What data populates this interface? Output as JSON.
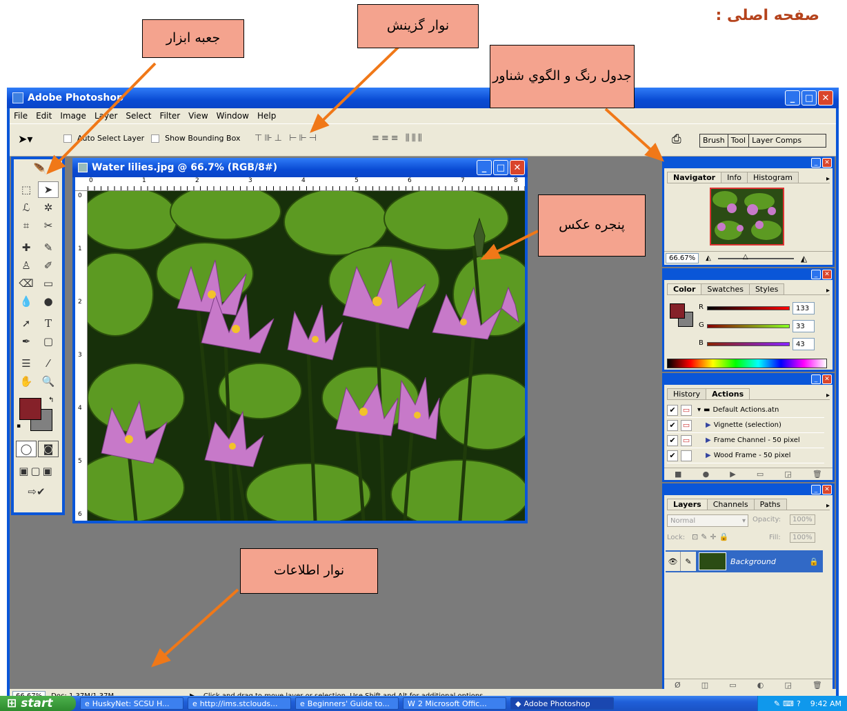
{
  "page_title": "صفحه اصلی :",
  "callouts": {
    "toolbox": "جعبه ابزار",
    "options_bar": "نوار گزینش",
    "palettes": "جدول رنگ و الگوي شناور",
    "image_window": "پنجره عکس",
    "status_bar": "نوار اطلاعات"
  },
  "app": {
    "title": "Adobe Photoshop",
    "menu": [
      "File",
      "Edit",
      "Image",
      "Layer",
      "Select",
      "Filter",
      "View",
      "Window",
      "Help"
    ],
    "options": {
      "auto_select": "Auto Select Layer",
      "bounding_box": "Show Bounding Box",
      "well_tabs": [
        "Brush",
        "Tool",
        "Layer Comps"
      ]
    }
  },
  "document": {
    "title": "Water lilies.jpg @ 66.7% (RGB/8#)",
    "ruler_top": [
      "0",
      "1",
      "2",
      "3",
      "4",
      "5",
      "6",
      "7",
      "8"
    ],
    "ruler_left": [
      "0",
      "1",
      "2",
      "3",
      "4",
      "5",
      "6"
    ]
  },
  "navigator": {
    "tabs": [
      "Navigator",
      "Info",
      "Histogram"
    ],
    "zoom": "66.67%"
  },
  "color": {
    "tabs": [
      "Color",
      "Swatches",
      "Styles"
    ],
    "r_label": "R",
    "r": "133",
    "g_label": "G",
    "g": "33",
    "b_label": "B",
    "b": "43",
    "foreground": "#852129"
  },
  "actions": {
    "tabs": [
      "History",
      "Actions"
    ],
    "items": [
      "Default Actions.atn",
      "Vignette (selection)",
      "Frame Channel - 50 pixel",
      "Wood Frame - 50 pixel"
    ]
  },
  "layers": {
    "tabs": [
      "Layers",
      "Channels",
      "Paths"
    ],
    "blend_mode": "Normal",
    "opacity_label": "Opacity:",
    "opacity": "100%",
    "lock_label": "Lock:",
    "fill_label": "Fill:",
    "fill": "100%",
    "layer_name": "Background"
  },
  "status": {
    "zoom": "66.67%",
    "doc": "Doc: 1.37M/1.37M",
    "hint": "Click and drag to move layer or selection.  Use Shift and Alt for additional options."
  },
  "taskbar": {
    "start": "start",
    "items": [
      "HuskyNet: SCSU H...",
      "http://ims.stclouds...",
      "Beginners' Guide to...",
      "2 Microsoft Offic...",
      "Adobe Photoshop"
    ],
    "clock": "9:42 AM"
  }
}
